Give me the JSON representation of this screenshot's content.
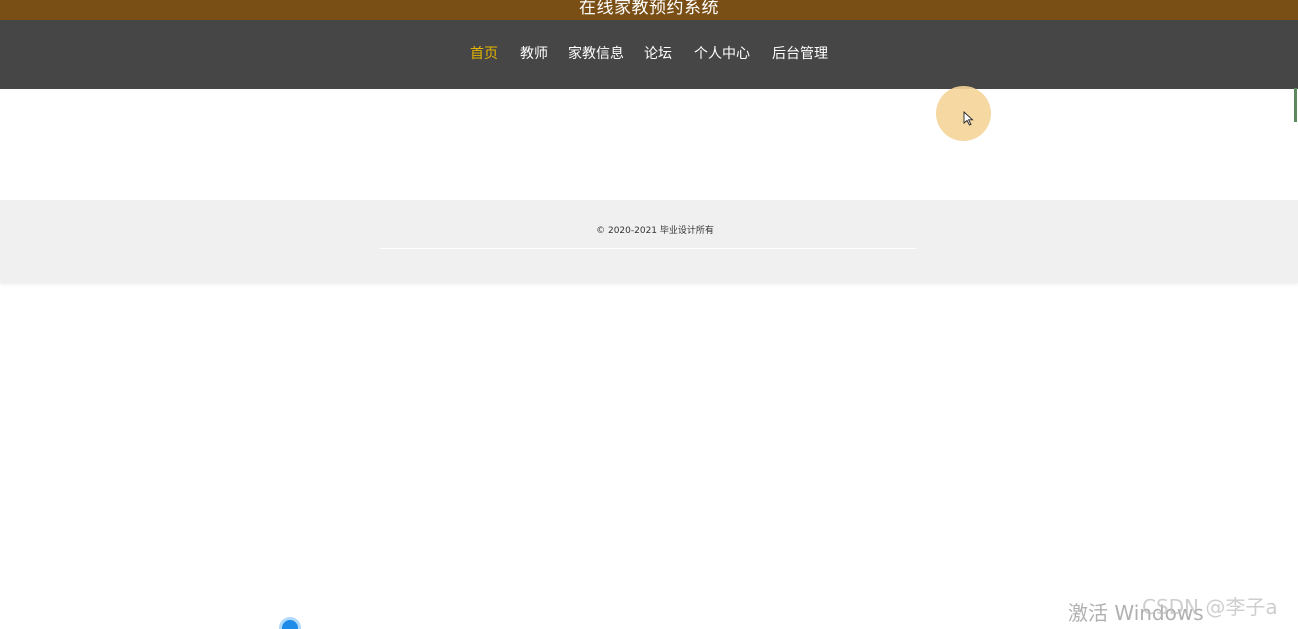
{
  "header": {
    "title": "在线家教预约系统"
  },
  "nav": {
    "items": [
      {
        "label": "首页",
        "active": true
      },
      {
        "label": "教师",
        "active": false
      },
      {
        "label": "家教信息",
        "active": false
      },
      {
        "label": "论坛",
        "active": false
      },
      {
        "label": "个人中心",
        "active": false
      },
      {
        "label": "后台管理",
        "active": false
      }
    ]
  },
  "footer": {
    "copyright": "© 2020-2021 毕业设计所有"
  },
  "overlay": {
    "activate_windows": "激活 Windows",
    "csdn_watermark": "CSDN @李子a"
  },
  "colors": {
    "title_bar": "#7a4f16",
    "nav_bg": "#464646",
    "nav_active": "#e3b400",
    "nav_text": "#ffffff",
    "footer_bg": "#f0f0f0"
  }
}
